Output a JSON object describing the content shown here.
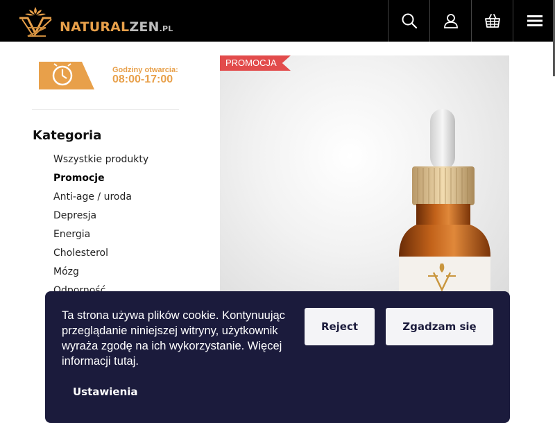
{
  "header": {
    "logo_part1": "NATURAL",
    "logo_part2": "ZEN",
    "logo_part3": ".PL",
    "icons": [
      "search-icon",
      "user-icon",
      "basket-icon",
      "menu-icon"
    ]
  },
  "hours": {
    "label": "Godziny otwarcia:",
    "time": "08:00-17:00"
  },
  "categories": {
    "title": "Kategoria",
    "items": [
      {
        "label": "Wszystkie produkty"
      },
      {
        "label": "Promocje",
        "active": true
      },
      {
        "label": "Anti-age / uroda"
      },
      {
        "label": "Depresja"
      },
      {
        "label": "Energia"
      },
      {
        "label": "Cholesterol"
      },
      {
        "label": "Mózg"
      },
      {
        "label": "Odporność"
      }
    ]
  },
  "product": {
    "badge": "PROMOCJA"
  },
  "cookie": {
    "text": "Ta strona używa plików cookie. Kontynuując przeglądanie niniejszej witryny, użytkownik wyraża zgodę na ich wykorzystanie. Więcej informacji tutaj.",
    "reject_label": "Reject",
    "accept_label": "Zgadzam się",
    "settings_label": "Ustawienia"
  },
  "colors": {
    "accent": "#e8a04a",
    "promo": "#e24b4b",
    "banner": "#1b1b3c",
    "header": "#000000"
  }
}
